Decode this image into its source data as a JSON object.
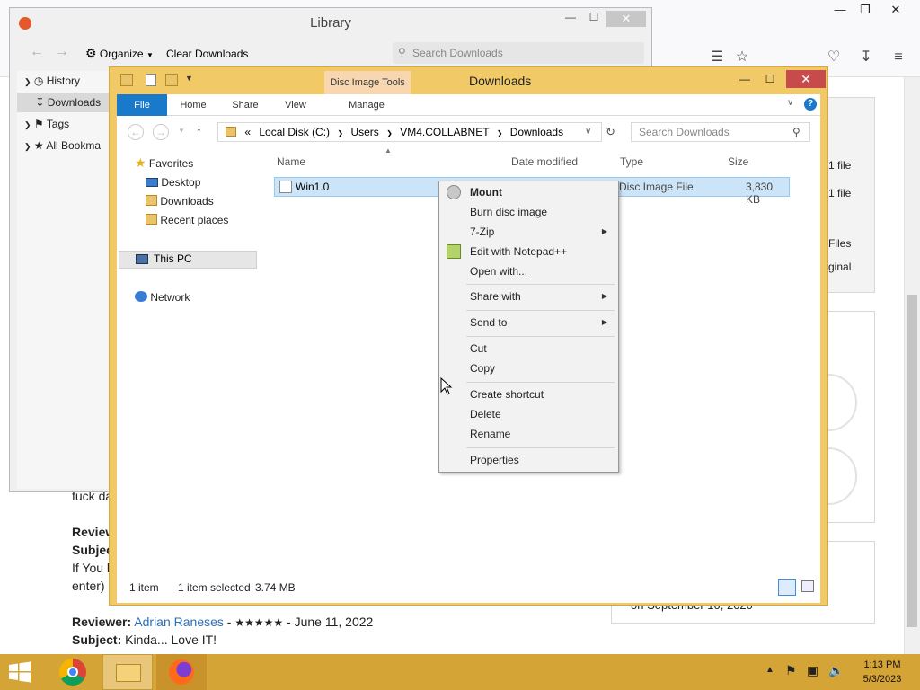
{
  "browser": {
    "reviews": [
      {
        "text": "fuck da"
      },
      {
        "label": "Reviewer:",
        "name": ""
      },
      {
        "label": "Subject:",
        "value": ""
      },
      {
        "line1": "If You h",
        "line2": "enter)"
      }
    ],
    "review2": {
      "reviewer_label": "Reviewer:",
      "reviewer_name": "Adrian Raneses",
      "rating": "★★★★★",
      "date": "- June 11, 2022",
      "subject_label": "Subject:",
      "subject": "Kinda... Love IT!"
    },
    "right_snippets": [
      "1 file",
      "1 file",
      "Files",
      "ginal"
    ],
    "right_bottom": "on September 10, 2020"
  },
  "library": {
    "title": "Library",
    "organize": "Organize",
    "clear_downloads": "Clear Downloads",
    "search_placeholder": "Search Downloads",
    "sidebar": [
      {
        "label": "History"
      },
      {
        "label": "Downloads"
      },
      {
        "label": "Tags"
      },
      {
        "label": "All Bookma"
      }
    ]
  },
  "explorer": {
    "title": "Downloads",
    "contextual_tab": "Disc Image Tools",
    "tabs": [
      {
        "label": "File"
      },
      {
        "label": "Home"
      },
      {
        "label": "Share"
      },
      {
        "label": "View"
      },
      {
        "label": "Manage"
      }
    ],
    "address": {
      "prefix": "«",
      "parts": [
        "Local Disk (C:)",
        "Users",
        "VM4.COLLABNET",
        "Downloads"
      ]
    },
    "search_placeholder": "Search Downloads",
    "nav": {
      "favorites": "Favorites",
      "desktop": "Desktop",
      "downloads": "Downloads",
      "recent": "Recent places",
      "thispc": "This PC",
      "network": "Network"
    },
    "columns": {
      "name": "Name",
      "date": "Date modified",
      "type": "Type",
      "size": "Size"
    },
    "file": {
      "name": "Win1.0",
      "type": "Disc Image File",
      "size": "3,830 KB"
    },
    "status": {
      "count": "1 item",
      "selected": "1 item selected",
      "size": "3.74 MB"
    }
  },
  "context_menu": {
    "items": [
      {
        "label": "Mount"
      },
      {
        "label": "Burn disc image"
      },
      {
        "label": "7-Zip"
      },
      {
        "label": "Edit with Notepad++"
      },
      {
        "label": "Open with..."
      },
      {
        "label": "Share with"
      },
      {
        "label": "Send to"
      },
      {
        "label": "Cut"
      },
      {
        "label": "Copy"
      },
      {
        "label": "Create shortcut"
      },
      {
        "label": "Delete"
      },
      {
        "label": "Rename"
      },
      {
        "label": "Properties"
      }
    ]
  },
  "taskbar": {
    "time": "1:13 PM",
    "date": "5/3/2023"
  },
  "colors": {
    "explorer_frame": "#f2c967",
    "taskbar": "#d5a437",
    "file_tab": "#1979ca",
    "selection": "#cce4f7",
    "close_red": "#c74b4b"
  }
}
